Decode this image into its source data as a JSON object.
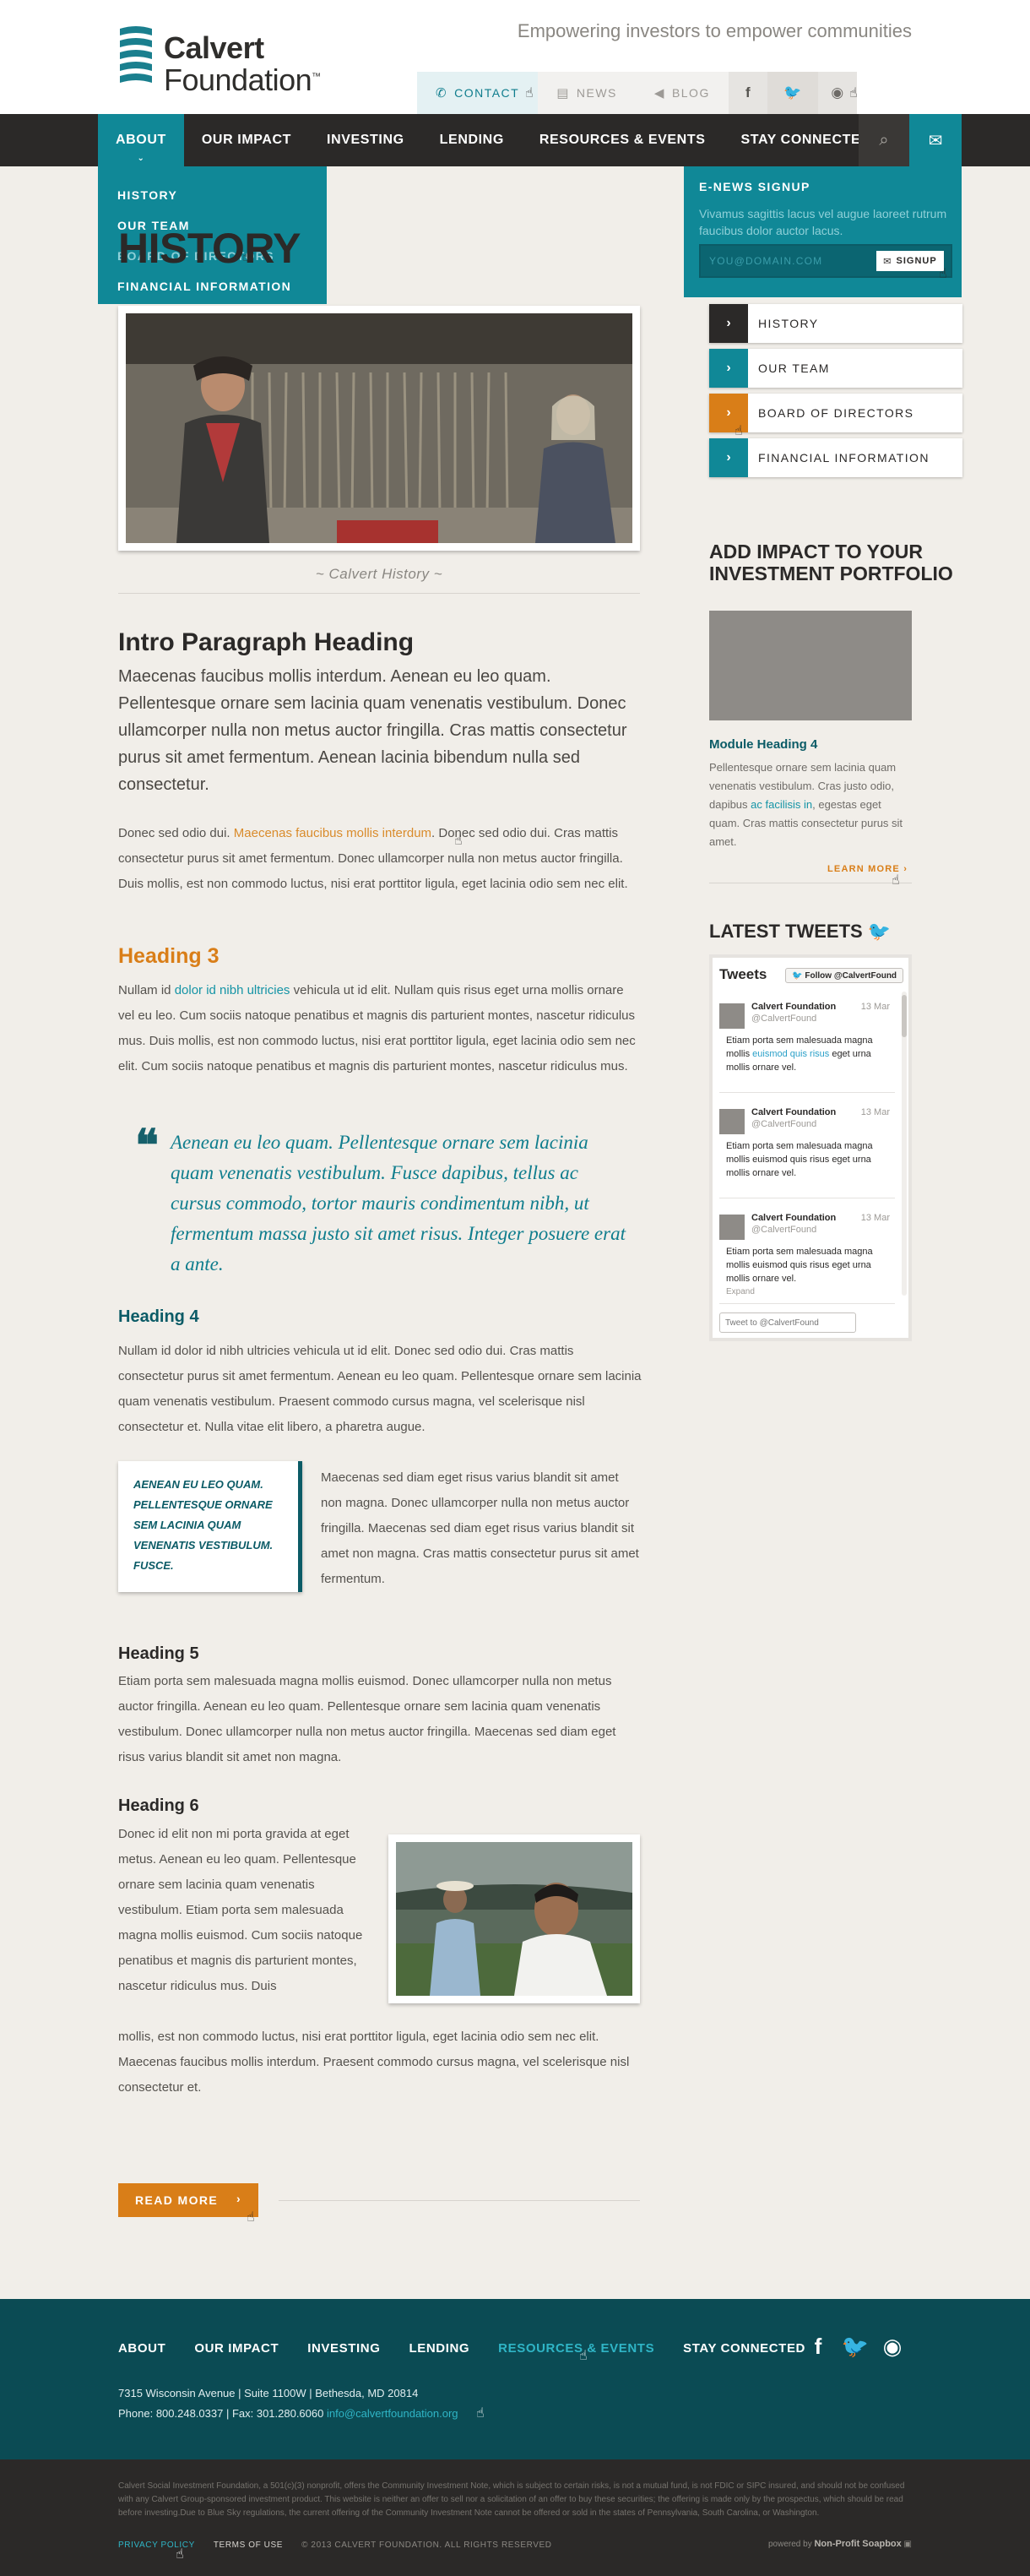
{
  "header": {
    "logo_line1": "Calvert",
    "logo_line2": "Foundation",
    "logo_tm": "™",
    "tagline": "Empowering investors to empower communities",
    "utility": [
      {
        "label": "Contact",
        "icon": "phone-icon"
      },
      {
        "label": "News",
        "icon": "document-icon"
      },
      {
        "label": "Blog",
        "icon": "megaphone-icon"
      }
    ],
    "social": [
      "facebook-icon",
      "twitter-icon",
      "rss-icon"
    ]
  },
  "nav": {
    "items": [
      "About",
      "Our Impact",
      "Investing",
      "Lending",
      "Resources & Events",
      "Stay Connected"
    ],
    "active": "About"
  },
  "dropdown": {
    "items": [
      "History",
      "Our Team",
      "Board of Directors",
      "Financial Information"
    ]
  },
  "enews": {
    "title": "E-News Signup",
    "text": "Vivamus sagittis lacus vel augue laoreet rutrum faucibus dolor auctor lacus.",
    "placeholder": "YOU@DOMAIN.COM",
    "button": "SIGNUP"
  },
  "main": {
    "title": "HISTORY",
    "title_prefix": "",
    "caption": "~ Calvert History ~",
    "intro_heading": "Intro Paragraph Heading",
    "intro_lead": "Maecenas faucibus mollis interdum. Aenean eu leo quam. Pellentesque ornare sem lacinia quam venenatis vestibulum. Donec ullamcorper nulla non metus auctor fringilla. Cras mattis consectetur purus sit amet fermentum. Aenean lacinia bibendum nulla sed consectetur.",
    "p1_a": "Donec sed odio dui. ",
    "p1_link": "Maecenas faucibus mollis interdum",
    "p1_b": ". Donec sed odio dui. Cras mattis consectetur purus sit amet fermentum. Donec ullamcorper nulla non metus auctor fringilla. Duis mollis, est non commodo luctus, nisi erat porttitor ligula, eget lacinia odio sem nec elit.",
    "h3": "Heading 3",
    "p2_a": "Nullam id ",
    "p2_link": "dolor id nibh ultricies",
    "p2_b": " vehicula ut id elit. Nullam quis risus eget urna mollis ornare vel eu leo. Cum sociis natoque penatibus et magnis dis parturient montes, nascetur ridiculus mus. Duis mollis, est non commodo luctus, nisi erat porttitor ligula, eget lacinia odio sem nec elit. Cum sociis natoque penatibus et magnis dis parturient montes, nascetur ridiculus mus.",
    "quote": "Aenean eu leo quam. Pellentesque ornare sem lacinia quam venenatis vestibulum. Fusce dapibus, tellus ac cursus commodo, tortor mauris condimentum nibh, ut fermentum massa justo sit amet risus. Integer posuere erat a ante.",
    "h4": "Heading 4",
    "p3": "Nullam id dolor id nibh ultricies vehicula ut id elit. Donec sed odio dui. Cras mattis consectetur purus sit amet fermentum. Aenean eu leo quam. Pellentesque ornare sem lacinia quam venenatis vestibulum. Praesent commodo cursus magna, vel scelerisque nisl consectetur et. Nulla vitae elit libero, a pharetra augue.",
    "callout": "Aenean eu leo quam. Pellentesque ornare sem lacinia quam venenatis vestibulum. Fusce.",
    "callout_text": "Maecenas sed diam eget risus varius blandit sit amet non magna. Donec ullamcorper nulla non metus auctor fringilla. Maecenas sed diam eget risus varius blandit sit amet non magna. Cras mattis consectetur purus sit amet fermentum.",
    "h5": "Heading 5",
    "p4": "Etiam porta sem malesuada magna mollis euismod. Donec ullamcorper nulla non metus auctor fringilla. Aenean eu leo quam. Pellentesque ornare sem lacinia quam venenatis vestibulum. Donec ullamcorper nulla non metus auctor fringilla. Maecenas sed diam eget risus varius blandit sit amet non magna.",
    "h6": "Heading 6",
    "p5": "Donec id elit non mi porta gravida at eget metus. Aenean eu leo quam. Pellentesque ornare sem lacinia quam venenatis vestibulum. Etiam porta sem malesuada magna mollis euismod. Cum sociis natoque penatibus et magnis dis parturient montes, nascetur ridiculus mus. Duis",
    "p5_tail": "mollis, est non commodo luctus, nisi erat porttitor ligula, eget lacinia odio sem nec elit. Maecenas faucibus mollis interdum. Praesent commodo cursus magna, vel scelerisque nisl consectetur et.",
    "read_more": "Read More",
    "read_more_icon": "chevron-right-icon"
  },
  "sidebar": {
    "subnav": [
      "History",
      "Our Team",
      "Board of Directors",
      "Financial Information"
    ],
    "impact_heading": "Add Impact to Your Investment Portfolio",
    "module_heading": "Module Heading 4",
    "module_text_a": "Pellentesque ornare sem lacinia quam venenatis vestibulum. Cras justo odio, dapibus ",
    "module_link": "ac facilisis in",
    "module_text_b": ", egestas eget quam. Cras mattis consectetur purus sit amet.",
    "learn_more": "Learn More",
    "tweets_heading": "Latest Tweets",
    "tweets_title": "Tweets",
    "follow": "Follow @CalvertFound",
    "tweets": [
      {
        "name": "Calvert Foundation",
        "handle": "@CalvertFound",
        "date": "13 Mar",
        "text_a": "Etiam porta sem malesuada magna mollis ",
        "link": "euismod quis risus",
        "text_b": " eget urna mollis ornare vel.",
        "expand": ""
      },
      {
        "name": "Calvert Foundation",
        "handle": "@CalvertFound",
        "date": "13 Mar",
        "text_a": "Etiam porta sem malesuada magna mollis euismod quis risus eget urna mollis ornare vel.",
        "link": "",
        "text_b": "",
        "expand": ""
      },
      {
        "name": "Calvert Foundation",
        "handle": "@CalvertFound",
        "date": "13 Mar",
        "text_a": "Etiam porta sem malesuada magna mollis euismod quis risus eget urna mollis ornare vel.",
        "link": "",
        "text_b": "",
        "expand": "Expand"
      }
    ],
    "tweet_placeholder": "Tweet to @CalvertFound"
  },
  "footer": {
    "nav": [
      "About",
      "Our Impact",
      "Investing",
      "Lending",
      "Resources & Events",
      "Stay Connected"
    ],
    "active": "Resources & Events",
    "address": "7315 Wisconsin Avenue  |  Suite 1100W  |  Bethesda, MD 20814",
    "phone": "Phone: 800.248.0337  |  Fax: 301.280.6060  ",
    "email": "info@calvertfoundation.org",
    "social": [
      "facebook-icon",
      "twitter-icon",
      "rss-icon"
    ],
    "disclaimer": "Calvert Social Investment Foundation, a 501(c)(3) nonprofit, offers the Community Investment Note, which is subject to certain risks, is not a mutual fund, is not FDIC or SIPC insured, and should not be confused with any Calvert Group-sponsored investment product. This website is neither an offer to sell nor a solicitation of an offer to buy these securities; the offering is made only by the prospectus, which should be read before investing.Due to Blue Sky regulations, the current offering of the Community Investment Note cannot be offered or sold in the states of Pennsylvania, South Carolina, or Washington.",
    "privacy": "Privacy Policy",
    "terms": "Terms of Use",
    "copyright": "© 2013 Calvert Foundation. All Rights Reserved",
    "powered_prefix": "powered by",
    "powered_name": "Non-Profit Soapbox"
  },
  "colors": {
    "teal": "#108897",
    "dark_teal": "#0b4b54",
    "orange": "#d97e18",
    "charcoal": "#2b2928",
    "page_bg": "#f1eee9"
  }
}
